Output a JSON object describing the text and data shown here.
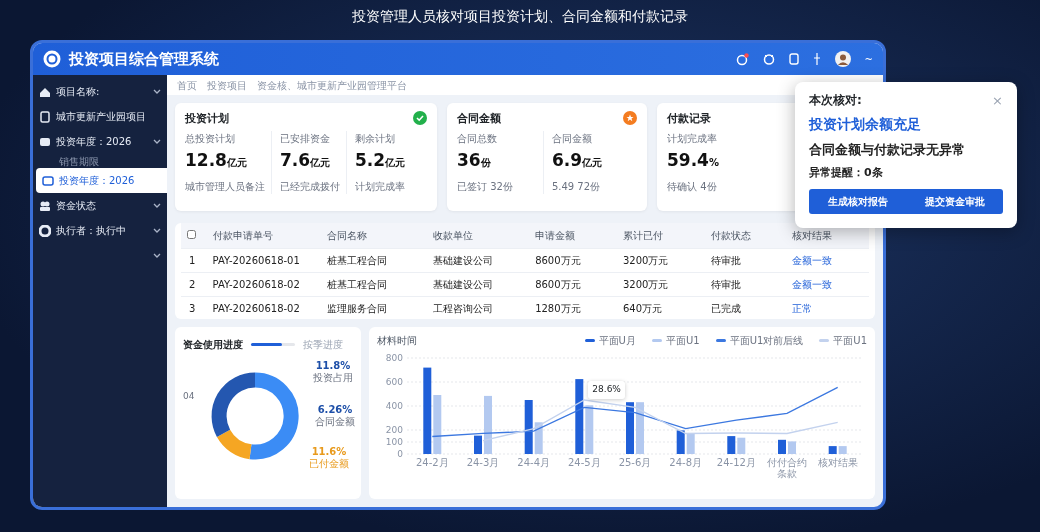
{
  "caption": "投资管理人员核对项目投资计划、合同金额和付款记录",
  "app": {
    "title": "投资项目综合管理系统",
    "has_alert": true,
    "more": "~"
  },
  "sidebar": {
    "items": [
      {
        "kind": "group",
        "label": "项目名称:",
        "selected": false
      },
      {
        "kind": "link",
        "label": "城市更新产业园项目",
        "selected": false
      },
      {
        "kind": "group",
        "label": "投资年度：2026",
        "selected": false
      },
      {
        "kind": "sub",
        "label": "销售期限",
        "selected": false
      },
      {
        "kind": "link",
        "label": "投资年度：2026",
        "selected": true
      },
      {
        "kind": "group",
        "label": "资金状态",
        "selected": false
      },
      {
        "kind": "group",
        "label": "执行者：执行中",
        "selected": false
      },
      {
        "kind": "more",
        "selected": false
      }
    ]
  },
  "breadcrumb": [
    "首页",
    "投资项目",
    "资金核、城市更新产业园管理平台"
  ],
  "cards": [
    {
      "title": "投资计划",
      "kind": "check",
      "stats": [
        {
          "label": "总投资计划",
          "value": "12.8",
          "unit": "亿元",
          "note": "城市管理人员备注"
        },
        {
          "label": "已安排资金",
          "value": "7.6",
          "unit": "亿元",
          "note": "已经完成拨付"
        },
        {
          "label": "剩余计划",
          "value": "5.2",
          "unit": "亿元",
          "note": "计划完成率"
        }
      ]
    },
    {
      "title": "合同金额",
      "kind": "star",
      "stats": [
        {
          "label": "合同总数",
          "value": "36",
          "unit": "份",
          "note": "已签订 32份"
        },
        {
          "label": "合同金额",
          "value": "6.9",
          "unit": "亿元",
          "note": "5.49 72份"
        }
      ]
    },
    {
      "title": "付款记录",
      "kind": "plain",
      "stats": [
        {
          "label": "计划完成率",
          "value": "59.4",
          "unit": "%",
          "note": "待确认 4份"
        }
      ]
    }
  ],
  "table": {
    "select_all": {
      "checked": false
    },
    "columns": [
      "付款申请单号",
      "合同名称",
      "收款单位",
      "申请金额",
      "累计已付",
      "付款状态",
      "核对结果"
    ],
    "rows": [
      {
        "index": "1",
        "cells": [
          "PAY-20260618-01",
          "桩基工程合同",
          "基础建设公司",
          "8600万元",
          "3200万元",
          "待审批"
        ],
        "result": "金额一致"
      },
      {
        "index": "2",
        "cells": [
          "PAY-20260618-02",
          "桩基工程合同",
          "基础建设公司",
          "8600万元",
          "3200万元",
          "待审批"
        ],
        "result": "金额一致"
      },
      {
        "index": "3",
        "cells": [
          "PAY-20260618-02",
          "监理服务合同",
          "工程咨询公司",
          "1280万元",
          "640万元",
          "已完成"
        ],
        "result": "正常"
      }
    ]
  },
  "progress": {
    "title": "资金使用进度",
    "level": 0.7,
    "legend": "按季进度",
    "labels": [
      {
        "value": "11.8%",
        "caption": "投资占用",
        "color": "#1d4fa8"
      },
      {
        "value": "6.26%",
        "caption": "合同金额",
        "color": "#1d4fa8"
      },
      {
        "value": "11.6%",
        "caption": "已付金额",
        "color": "#e89a1c"
      }
    ],
    "side_label": "04"
  },
  "trend": {
    "chart_data": {
      "type": "bar",
      "title": "材料时间",
      "categories": [
        "24-2月",
        "24-3月",
        "24-4月",
        "24-5月",
        "25-6月",
        "24-8月",
        "24-12月",
        "付付合约条款",
        "核对结果"
      ],
      "series": [
        {
          "name": "平面U月",
          "color": "#1f5fd8",
          "type": "bar",
          "values": [
            720,
            153,
            450,
            624,
            432,
            197,
            149,
            118,
            66
          ]
        },
        {
          "name": "平面U1",
          "color": "#b3c9f0",
          "type": "bar",
          "values": [
            492,
            484,
            264,
            406,
            432,
            175,
            136,
            105,
            66
          ]
        },
        {
          "name": "平面U1对前后线",
          "color": "#3c78e0",
          "type": "line",
          "values": [
            146,
            172,
            190,
            388,
            344,
            212,
            282,
            338,
            556
          ]
        },
        {
          "name": "平面U1",
          "color": "#c3d2ee",
          "type": "line",
          "values": [
            null,
            111,
            212,
            450,
            388,
            171,
            175,
            171,
            264
          ]
        }
      ],
      "ylim": [
        0,
        800
      ],
      "grid": true,
      "legend": "top-right",
      "yticks": [
        0,
        100,
        200,
        400,
        600,
        800
      ],
      "annotations": [
        {
          "x": "24-5月",
          "text": "28.6%"
        }
      ]
    }
  },
  "popup": {
    "heading": "本次核对:",
    "highlight": "投资计划余额充足",
    "message": "合同金额与付款记录无异常",
    "alert": "异常提醒：0条",
    "close": "×",
    "actions": [
      "生成核对报告",
      "提交资金审批"
    ]
  }
}
